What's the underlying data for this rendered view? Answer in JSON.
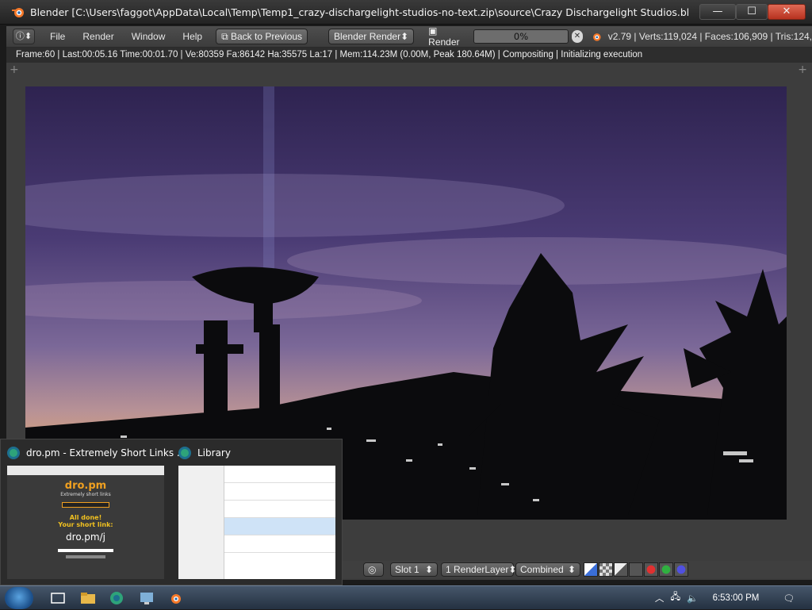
{
  "window": {
    "title": "Blender [C:\\Users\\faggot\\AppData\\Local\\Temp\\Temp1_crazy-dischargelight-studios-no-text.zip\\source\\Crazy Dischargelight Studios.blend]",
    "minimize": "—",
    "maximize": "☐",
    "close": "✕"
  },
  "header": {
    "editor_type": "ⓘ⬍",
    "menus": [
      "File",
      "Render",
      "Window",
      "Help"
    ],
    "back_button": "Back to Previous",
    "engine": "Blender Render",
    "render_label": "Render",
    "progress_text": "0%",
    "progress_fraction": 0.0,
    "stats": "v2.79 | Verts:119,024 | Faces:106,909 | Tris:124,"
  },
  "status_line": "Frame:60 | Last:00:05.16 Time:00:01.70 | Ve:80359 Fa:86142 Ha:35575 La:17 | Mem:114.23M (0.00M, Peak 180.64M) | Compositing | Initializing execution",
  "image_footer": {
    "slot": "Slot 1",
    "render_layer": "1 RenderLayer",
    "pass": "Combined"
  },
  "thumbnails": [
    {
      "title": "dro.pm - Extremely Short Links ...",
      "site_name": "dro.pm",
      "site_tagline": "Extremely short links",
      "done_text": "All done!",
      "short_link_label": "Your short link:",
      "short_link": "dro.pm/j"
    },
    {
      "title": "Library"
    }
  ],
  "taskbar": {
    "time": "6:53:00 PM"
  },
  "colors": {
    "sky_top": "#3a2c66",
    "sky_mid": "#6b5a8f",
    "horizon": "#d6a070",
    "progress_bg": "#6d6d6d"
  }
}
